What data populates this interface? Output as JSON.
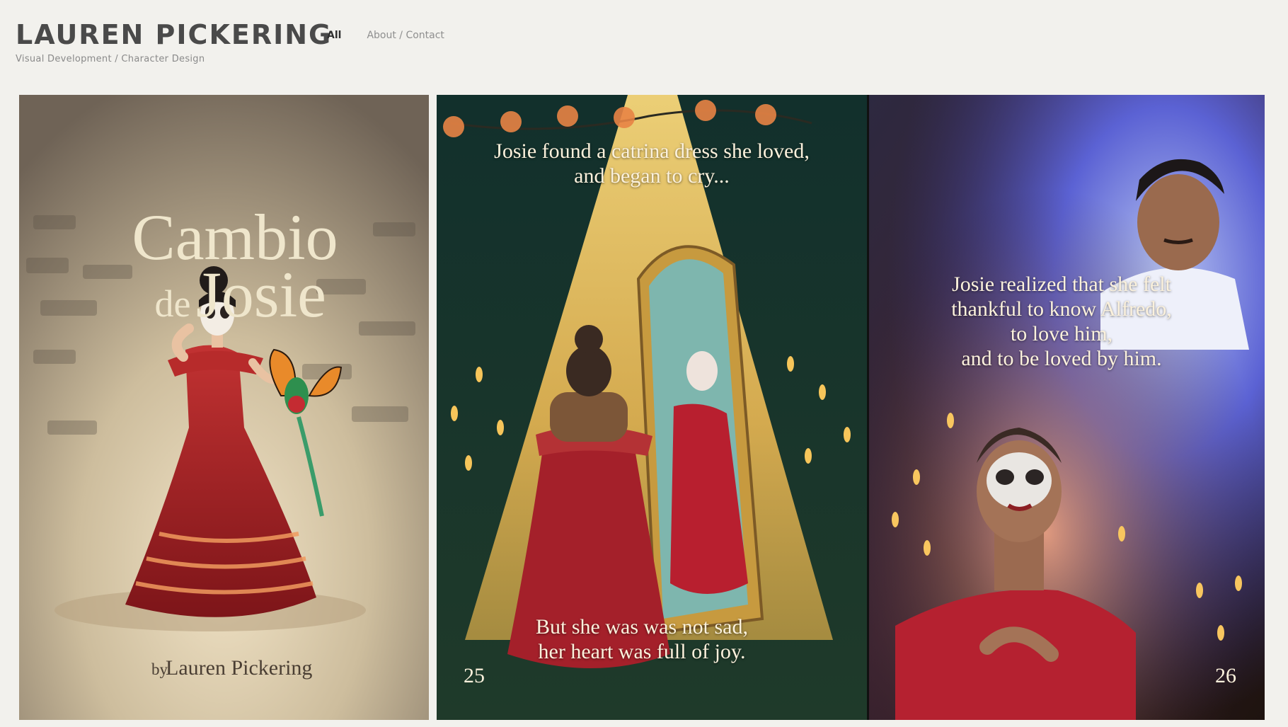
{
  "header": {
    "title": "LAUREN PICKERING",
    "tagline": "Visual Development / Character Design"
  },
  "nav": {
    "items": [
      {
        "label": "All",
        "active": true
      },
      {
        "label": "About / Contact",
        "active": false
      }
    ]
  },
  "gallery": {
    "cover": {
      "title_line1": "Cambio",
      "title_de": "de",
      "title_line2": "Josie",
      "byline_by": "by",
      "byline_name": "Lauren Pickering"
    },
    "page_left": {
      "caption_top_1": "Josie found a catrina dress she loved,",
      "caption_top_2": "and began to cry...",
      "caption_bottom_1": "But she was was not sad,",
      "caption_bottom_2": "her heart was full of joy.",
      "page_number": "25"
    },
    "page_right": {
      "caption_1": "Josie realized that she felt",
      "caption_2": "thankful to know Alfredo,",
      "caption_3": "to love him,",
      "caption_4": "and to be loved by him.",
      "page_number": "26"
    }
  },
  "colors": {
    "background": "#f2f1ed",
    "title": "#4a4a4a",
    "dress_red": "#a4202a",
    "caption_text": "#fbf1dc"
  }
}
